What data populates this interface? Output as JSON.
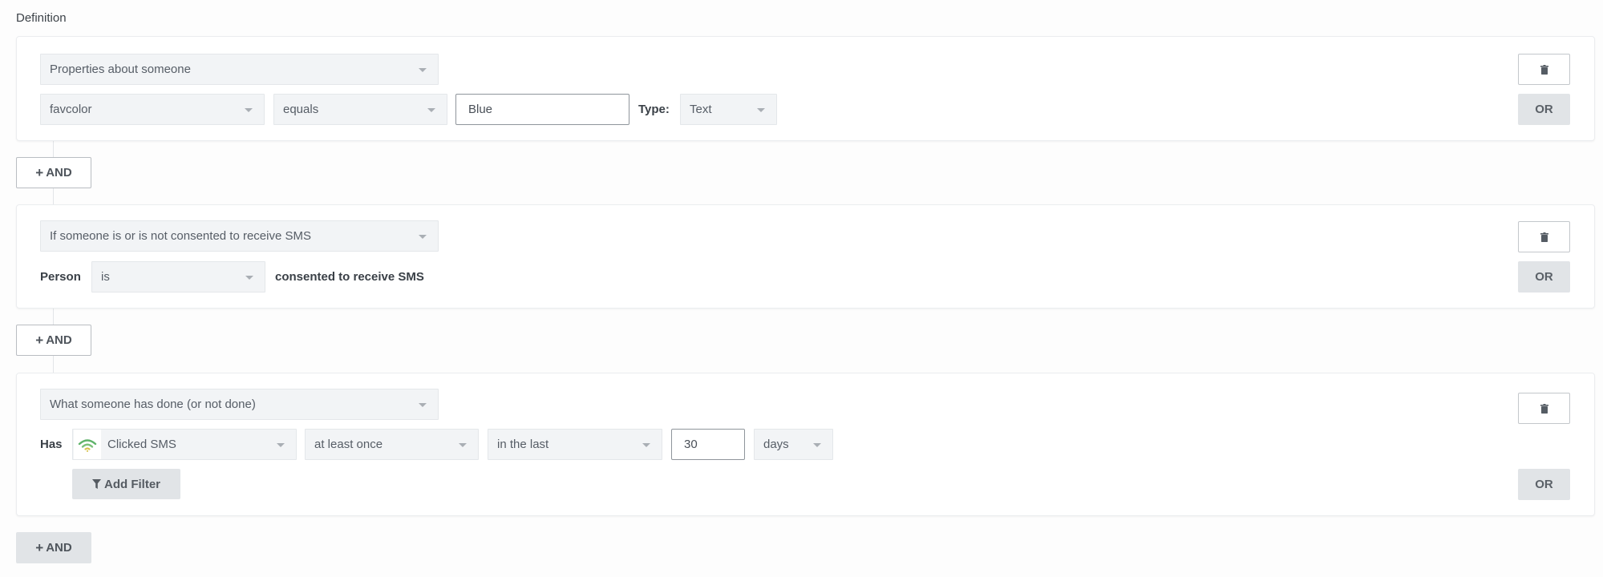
{
  "section_title": "Definition",
  "conditions": [
    {
      "type_select": "Properties about someone",
      "property_select": "favcolor",
      "operator_select": "equals",
      "value_input": "Blue",
      "type_label": "Type:",
      "datatype_select": "Text",
      "delete_icon": "trash-icon",
      "or_label": "OR"
    },
    {
      "type_select": "If someone is or is not consented to receive SMS",
      "person_label": "Person",
      "consent_select": "is",
      "consent_text": "consented to receive SMS",
      "delete_icon": "trash-icon",
      "or_label": "OR"
    },
    {
      "type_select": "What someone has done (or not done)",
      "has_label": "Has",
      "metric_icon": "sms-signal-icon",
      "metric_select": "Clicked SMS",
      "frequency_select": "at least once",
      "timeframe_select": "in the last",
      "timeframe_value": "30",
      "timeframe_unit_select": "days",
      "add_filter_label": "Add Filter",
      "filter_icon": "funnel-icon",
      "delete_icon": "trash-icon",
      "or_label": "OR"
    }
  ],
  "and_buttons": [
    {
      "label": "AND",
      "icon": "plus-icon"
    },
    {
      "label": "AND",
      "icon": "plus-icon"
    },
    {
      "label": "AND",
      "icon": "plus-icon"
    }
  ],
  "colors": {
    "select_bg": "#f2f4f6",
    "button_gray": "#e1e4e7",
    "metric_icon_green": "#5fb36a",
    "metric_icon_yellow": "#d6c14a"
  }
}
